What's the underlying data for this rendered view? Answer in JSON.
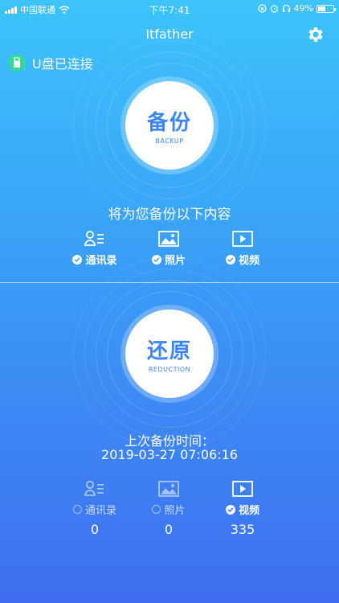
{
  "status_bar": {
    "carrier": "中国联通",
    "time": "下午7:41",
    "battery": "49%",
    "battery_level": 0.49
  },
  "nav": {
    "title": "Itfather",
    "settings_icon": "gear-icon"
  },
  "usb": {
    "icon": "usb-drive-icon",
    "label": "U盘已连接"
  },
  "backup": {
    "title": "备份",
    "subtitle": "BACKUP",
    "info": "将为您备份以下内容",
    "items": [
      {
        "label": "通讯录",
        "icon": "contacts-icon",
        "checked": true
      },
      {
        "label": "照片",
        "icon": "photo-icon",
        "checked": true
      },
      {
        "label": "视频",
        "icon": "video-icon",
        "checked": true
      }
    ]
  },
  "restore": {
    "title": "还原",
    "subtitle": "REDUCTION",
    "last_backup_label": "上次备份时间：",
    "last_backup_time": "2019-03-27 07:06:16",
    "items": [
      {
        "label": "通讯录",
        "icon": "contacts-icon",
        "checked": false,
        "count": "0"
      },
      {
        "label": "照片",
        "icon": "photo-icon",
        "checked": false,
        "count": "0"
      },
      {
        "label": "视频",
        "icon": "video-icon",
        "checked": true,
        "count": "335"
      }
    ]
  },
  "colors": {
    "top": "#3cc4fb",
    "bottom": "#3f6ef0",
    "accent": "#3a86f5",
    "usb_green": "#35d89b"
  }
}
